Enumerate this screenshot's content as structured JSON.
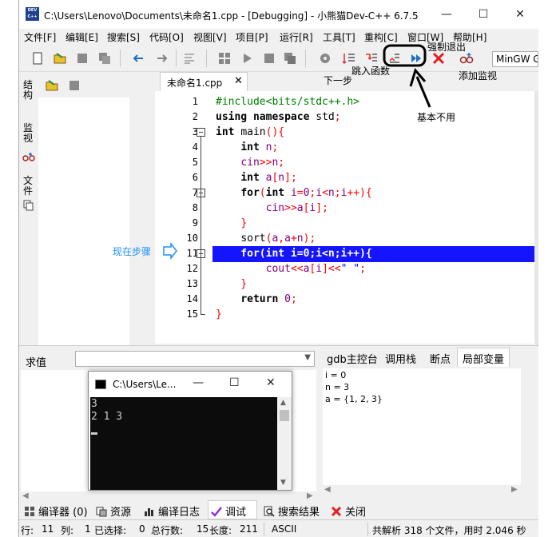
{
  "window": {
    "title": "C:\\Users\\Lenovo\\Documents\\未命名1.cpp - [Debugging] - 小熊猫Dev-C++ 6.7.5",
    "app_icon_text": "DEV C++",
    "minimize": "—",
    "maximize": "☐",
    "close": "✕"
  },
  "menu": [
    "文件[F]",
    "编辑[E]",
    "搜索[S]",
    "代码[O]",
    "视图[V]",
    "项目[P]",
    "运行[R]",
    "工具[T]",
    "重构[C]",
    "窗口[W]",
    "帮助[H]"
  ],
  "toolbar": {
    "compiler": "MinGW G"
  },
  "left_tabs": [
    "结构",
    "监视",
    "文件"
  ],
  "editor": {
    "tab_label": "未命名1.cpp",
    "tab_close": "✕",
    "line_numbers": [
      "1",
      "2",
      "3",
      "4",
      "5",
      "6",
      "7",
      "8",
      "9",
      "10",
      "11",
      "12",
      "13",
      "14",
      "15"
    ],
    "current_line": 11,
    "lines": [
      "#include<bits/stdc++.h>",
      "using namespace std;",
      "int main(){",
      "    int n;",
      "    cin>>n;",
      "    int a[n];",
      "    for(int i=0;i<n;i++){",
      "        cin>>a[i];",
      "    }",
      "    sort(a,a+n);",
      "    for(int i=0;i<n;i++){",
      "        cout<<a[i]<<\" \";",
      "    }",
      "    return 0;",
      "}"
    ]
  },
  "annotations": {
    "step": "下一步",
    "step_into": "跳入函数",
    "force_quit": "强制退出",
    "add_watch": "添加监视",
    "rarely_used": "基本不用",
    "current_step": "现在步骤"
  },
  "eval": {
    "label": "求值",
    "value": ""
  },
  "debug_tabs": [
    "gdb主控台",
    "调用栈",
    "断点",
    "局部变量"
  ],
  "locals": [
    "i = 0",
    "n = 3",
    "a = {1, 2, 3}"
  ],
  "console": {
    "title": "C:\\Users\\Le...",
    "minimize": "—",
    "maximize": "☐",
    "close": "✕",
    "lines": [
      "3",
      "2 1 3"
    ]
  },
  "panel_tabs": [
    "编译器 (0)",
    "资源",
    "编译日志",
    "调试",
    "搜索结果",
    "关闭"
  ],
  "status": {
    "row_label": "行:",
    "row": "11",
    "col_label": "列:",
    "col": "1",
    "sel_label": "已选择:",
    "sel": "0",
    "lines_label": "总行数:",
    "lines": "15",
    "len_label": "长度:",
    "len": "211",
    "encoding": "ASCII",
    "parse": "共解析 318 个文件，用时 2.046 秒"
  },
  "colors": {
    "highlight": "#1414ff",
    "keyword": "#000000",
    "preprocessor": "#008000",
    "symbol": "#ff0000",
    "variable": "#800080",
    "string": "#0000ff",
    "annotation_blue": "#1e90ff"
  }
}
